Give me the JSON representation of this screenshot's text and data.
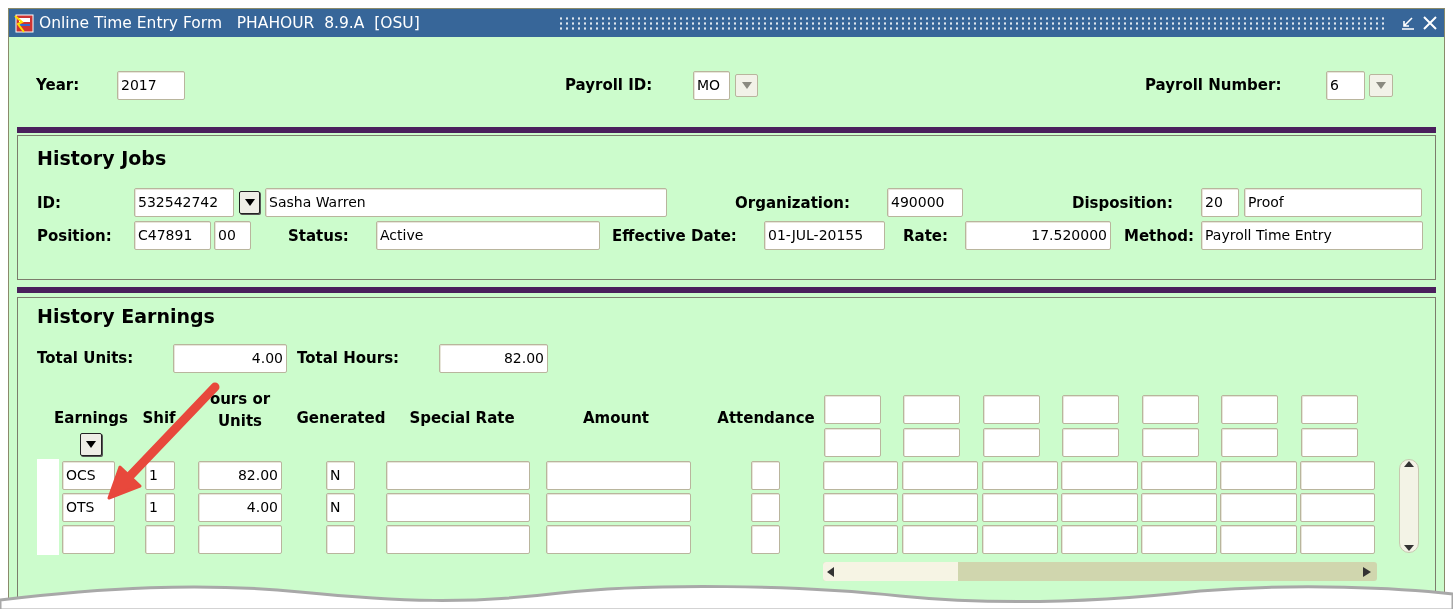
{
  "window": {
    "title": "Online Time Entry Form   PHAHOUR  8.9.A  [OSU]"
  },
  "key_block": {
    "year": {
      "label": "Year:",
      "value": "2017"
    },
    "payroll_id": {
      "label": "Payroll ID:",
      "value": "MO"
    },
    "payroll_number": {
      "label": "Payroll Number:",
      "value": "6"
    }
  },
  "history_jobs": {
    "title": "History Jobs",
    "id": {
      "label": "ID:",
      "value": "532542742",
      "name": "Sasha Warren"
    },
    "organization": {
      "label": "Organization:",
      "value": "490000"
    },
    "disposition": {
      "label": "Disposition:",
      "code": "20",
      "value": "Proof"
    },
    "position": {
      "label": "Position:",
      "value": "C47891",
      "suffix": "00"
    },
    "status": {
      "label": "Status:",
      "value": "Active"
    },
    "effective_date": {
      "label": "Effective Date:",
      "value": "01-JUL-20155"
    },
    "rate": {
      "label": "Rate:",
      "value": "17.520000"
    },
    "method": {
      "label": "Method:",
      "value": "Payroll Time Entry"
    }
  },
  "history_earnings": {
    "title": "History Earnings",
    "total_units": {
      "label": "Total Units:",
      "value": "4.00"
    },
    "total_hours": {
      "label": "Total Hours:",
      "value": "82.00"
    },
    "columns": [
      "Earnings",
      "Shif",
      "ours or Units",
      "Generated",
      "Special Rate",
      "Amount",
      "Attendance"
    ],
    "rows": [
      {
        "earnings": "OCS",
        "shift": "1",
        "hours": "82.00",
        "generated": "N"
      },
      {
        "earnings": "OTS",
        "shift": "1",
        "hours": "4.00",
        "generated": "N"
      },
      {}
    ]
  }
}
